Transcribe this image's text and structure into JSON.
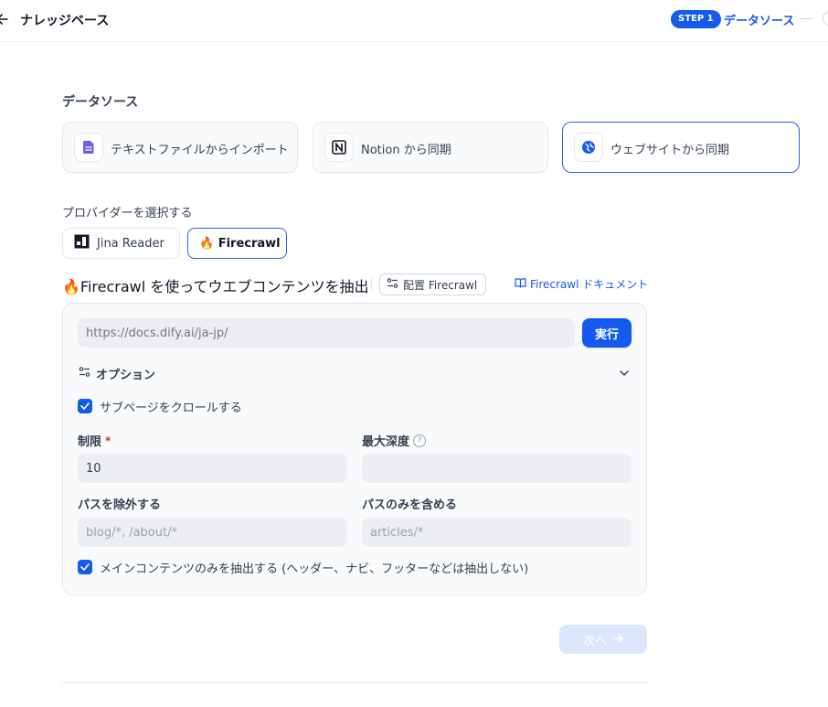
{
  "header": {
    "back_icon": "arrow-left-icon",
    "title": "ナレッジベース",
    "step_badge": "STEP 1",
    "step_label": "データソース",
    "accent": "#155aef"
  },
  "datasource": {
    "title": "データソース",
    "options": [
      {
        "label": "テキストファイルからインポート",
        "icon": "file-text-icon",
        "active": false
      },
      {
        "label": "Notion から同期",
        "icon": "notion-icon",
        "active": false
      },
      {
        "label": "ウェブサイトから同期",
        "icon": "globe-icon",
        "active": true
      }
    ]
  },
  "provider": {
    "title": "プロバイダーを選択する",
    "options": [
      {
        "label": "Jina Reader",
        "icon": "jina-logo-icon",
        "active": false
      },
      {
        "label": "🔥 Firecrawl",
        "icon": "fire-icon",
        "active": true
      }
    ]
  },
  "crawler": {
    "heading": "🔥Firecrawl を使ってウエブコンテンツを抽出",
    "config_button": "配置 Firecrawl",
    "doc_link": "Firecrawl ドキュメント",
    "url_placeholder": "https://docs.dify.ai/ja-jp/",
    "run_button": "実行",
    "options_label": "オプション",
    "crawl_subpages": {
      "label": "サブページをクロールする",
      "checked": true
    },
    "limit": {
      "label": "制限",
      "required_mark": "*",
      "value": "10"
    },
    "max_depth": {
      "label": "最大深度",
      "help": "?",
      "value": ""
    },
    "exclude_paths": {
      "label": "パスを除外する",
      "placeholder": "blog/*, /about/*"
    },
    "include_paths": {
      "label": "パスのみを含める",
      "placeholder": "articles/*"
    },
    "main_content_only": {
      "label": "メインコンテンツのみを抽出する (ヘッダー、ナビ、フッターなどは抽出しない)",
      "checked": true
    }
  },
  "footer": {
    "next_button": "次へ",
    "next_icon": "arrow-right-icon"
  }
}
